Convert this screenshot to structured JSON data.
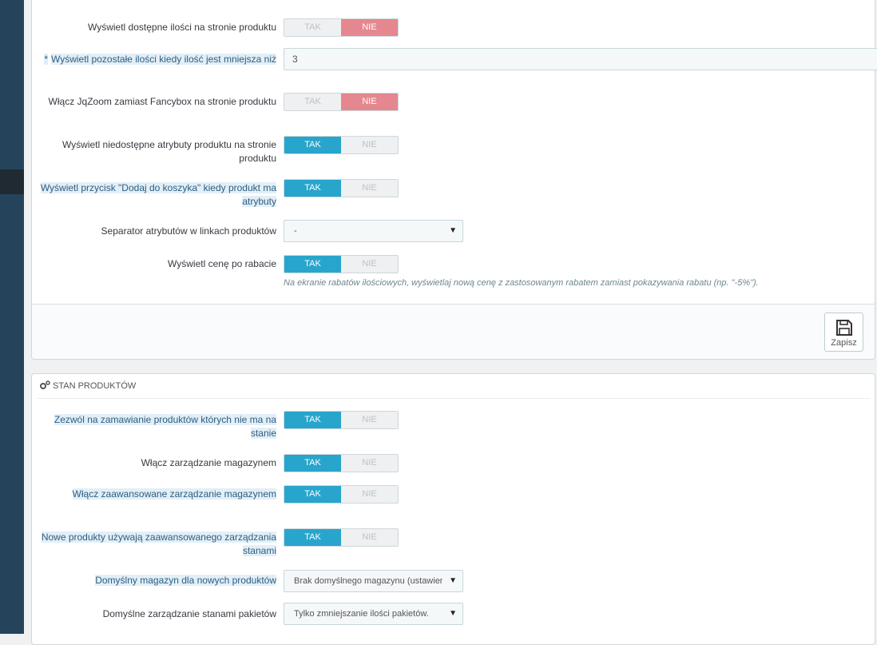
{
  "top_form": {
    "rows": [
      {
        "label": "Wyświetl dostępne ilości na stronie produktu",
        "yes": "TAK",
        "no": "NIE"
      },
      {
        "label": "Wyświetl pozostałe ilości kiedy ilość jest mniejsza niż",
        "required_mark": "*",
        "value": "3"
      },
      {
        "label": "Włącz JqZoom zamiast Fancybox na stronie produktu",
        "yes": "TAK",
        "no": "NIE"
      },
      {
        "label": "Wyświetl niedostępne atrybuty produktu na stronie produktu",
        "yes": "TAK",
        "no": "NIE"
      },
      {
        "label": "Wyświetl przycisk \"Dodaj do koszyka\" kiedy produkt ma atrybuty",
        "yes": "TAK",
        "no": "NIE"
      },
      {
        "label": "Separator atrybutów w linkach produktów",
        "value": "-"
      },
      {
        "label": "Wyświetl cenę po rabacie",
        "yes": "TAK",
        "no": "NIE",
        "help": "Na ekranie rabatów ilościowych, wyświetlaj nową cenę z zastosowanym rabatem zamiast pokazywania rabatu (np. \"-5%\")."
      }
    ],
    "save_label": "Zapisz"
  },
  "stock_panel": {
    "title": "STAN PRODUKTÓW",
    "rows": [
      {
        "label": "Zezwól na zamawianie produktów których nie ma na stanie",
        "yes": "TAK",
        "no": "NIE"
      },
      {
        "label": "Włącz zarządzanie magazynem",
        "yes": "TAK",
        "no": "NIE"
      },
      {
        "label": "Włącz zaawansowane zarządzanie magazynem",
        "yes": "TAK",
        "no": "NIE"
      },
      {
        "label": "Nowe produkty używają zaawansowanego zarządzania stanami",
        "yes": "TAK",
        "no": "NIE"
      },
      {
        "label": "Domyślny magazyn dla nowych produktów",
        "value": "Brak domyślnego magazynu (ustawienie domyślne)"
      },
      {
        "label": "Domyślne zarządzanie stanami pakietów",
        "value": "Tylko zmniejszanie ilości pakietów."
      }
    ]
  },
  "colors": {
    "sidebar": "#25445b",
    "switch_yes_active": "#28a5cc",
    "switch_no_active": "#e5878e",
    "hint_label_bg": "#e2eff7"
  }
}
